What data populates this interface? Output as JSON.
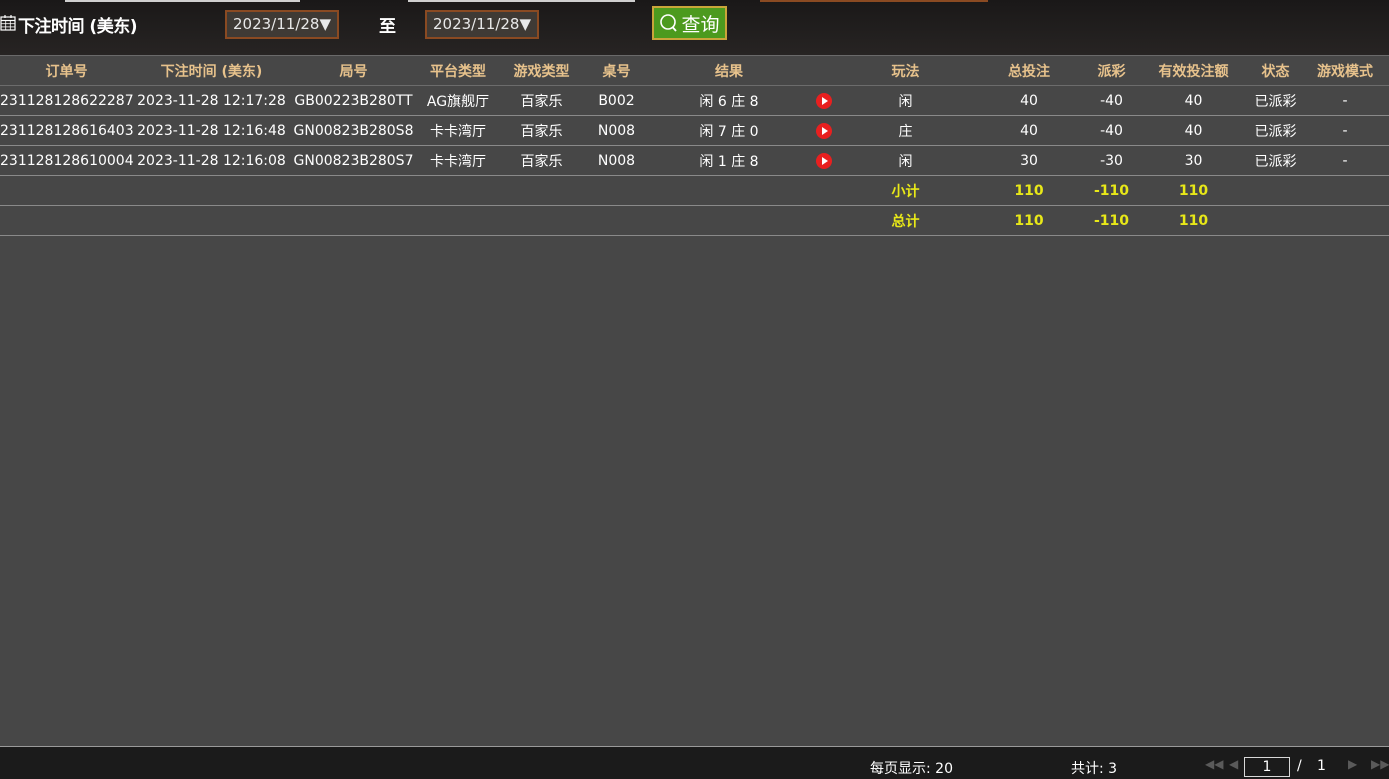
{
  "filter": {
    "label": "下注时间 (美东)",
    "start_date": "2023/11/28▼",
    "to_label": "至",
    "end_date": "2023/11/28▼",
    "query_label": "查询"
  },
  "table": {
    "headers": [
      "订单号",
      "下注时间 (美东)",
      "局号",
      "平台类型",
      "游戏类型",
      "桌号",
      "结果",
      "",
      "玩法",
      "总投注",
      "派彩",
      "有效投注额",
      "状态",
      "游戏模式"
    ],
    "rows": [
      {
        "order": "231128128622287",
        "time": "2023-11-28 12:17:28",
        "round": "GB00223B280TT",
        "platform": "AG旗舰厅",
        "game": "百家乐",
        "table": "B002",
        "result": "闲 6 庄 8",
        "play": "闲",
        "bet": "40",
        "payout": "-40",
        "valid": "40",
        "status": "已派彩",
        "mode": "-"
      },
      {
        "order": "231128128616403",
        "time": "2023-11-28 12:16:48",
        "round": "GN00823B280S8",
        "platform": "卡卡湾厅",
        "game": "百家乐",
        "table": "N008",
        "result": "闲 7 庄 0",
        "play": "庄",
        "bet": "40",
        "payout": "-40",
        "valid": "40",
        "status": "已派彩",
        "mode": "-"
      },
      {
        "order": "231128128610004",
        "time": "2023-11-28 12:16:08",
        "round": "GN00823B280S7",
        "platform": "卡卡湾厅",
        "game": "百家乐",
        "table": "N008",
        "result": "闲 1 庄 8",
        "play": "闲",
        "bet": "30",
        "payout": "-30",
        "valid": "30",
        "status": "已派彩",
        "mode": "-"
      }
    ],
    "subtotal": {
      "label": "小计",
      "bet": "110",
      "payout": "-110",
      "valid": "110"
    },
    "total": {
      "label": "总计",
      "bet": "110",
      "payout": "-110",
      "valid": "110"
    }
  },
  "footer": {
    "per_page": "每页显示: 20",
    "count": "共计: 3",
    "current_page": "1",
    "separator": "/",
    "total_pages": "1"
  },
  "colors": {
    "header_text": "#e7c28c",
    "positive_green": "#3cd81e",
    "summary_yellow": "#e8e818",
    "accent_orange": "#8a4a22"
  }
}
